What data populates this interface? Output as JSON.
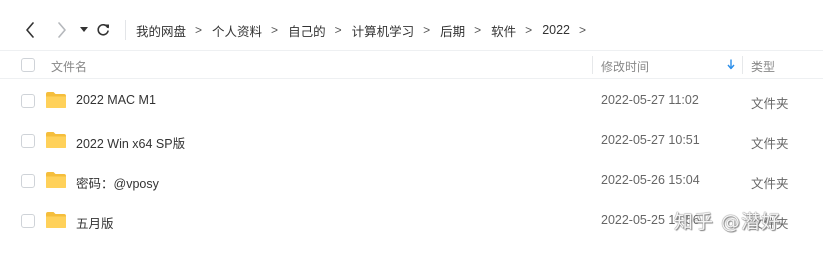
{
  "toolbar": {
    "back_icon": "chevron-left-icon",
    "forward_icon": "chevron-right-icon",
    "history_icon": "caret-down-icon",
    "refresh_icon": "refresh-icon"
  },
  "breadcrumb": {
    "items": [
      "我的网盘",
      "个人资料",
      "自己的",
      "计算机学习",
      "后期",
      "软件",
      "2022"
    ],
    "separator": ">"
  },
  "columns": {
    "name": "文件名",
    "modified": "修改时间",
    "type": "类型",
    "sort_icon": "arrow-down-icon"
  },
  "files": [
    {
      "name": "2022 MAC M1",
      "modified": "2022-05-27 11:02",
      "type": "文件夹"
    },
    {
      "name": "2022 Win x64 SP版",
      "modified": "2022-05-27 10:51",
      "type": "文件夹"
    },
    {
      "name": "密码：@vposy",
      "modified": "2022-05-26 15:04",
      "type": "文件夹"
    },
    {
      "name": "五月版",
      "modified": "2022-05-25 14:56",
      "type": "文件夹"
    }
  ],
  "watermark": "知乎 @潜好",
  "colors": {
    "folder": "#FFD15A",
    "folder_dark": "#F5BE3C",
    "accent": "#2A8EEA"
  }
}
